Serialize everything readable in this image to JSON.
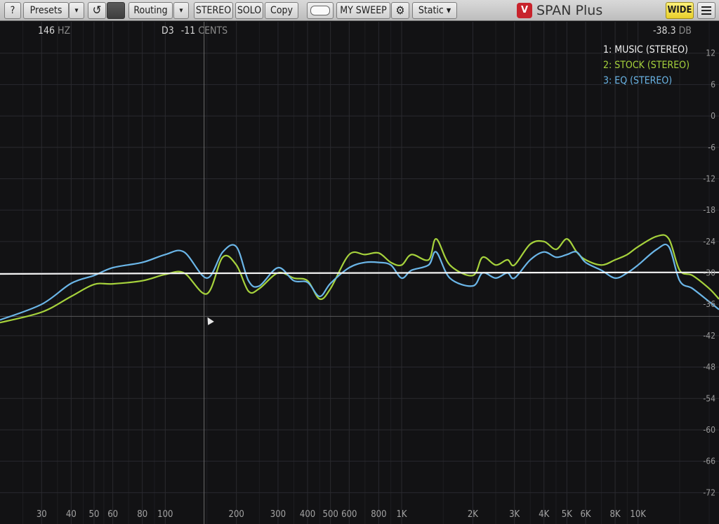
{
  "toolbar": {
    "help_label": "?",
    "presets_label": "Presets",
    "presets_dropdown": "▾",
    "undo_icon": "↺",
    "routing_label": "Routing",
    "routing_dropdown": "▾",
    "stereo_label": "STEREO",
    "solo_label": "SOLO",
    "copy_label": "Copy",
    "sweep_label": "MY SWEEP",
    "static_label": "Static ▾",
    "brand_logo": "V",
    "brand_name": "SPAN Plus",
    "wide_label": "WIDE"
  },
  "readout": {
    "freq_value": "146",
    "freq_unit": "HZ",
    "note": "D3",
    "cents_value": "-11",
    "cents_unit": "CENTS",
    "level_value": "-38.3",
    "level_unit": "DB"
  },
  "legend": [
    {
      "label": "1: MUSIC (STEREO)",
      "color": "#f2f2f2"
    },
    {
      "label": "2: STOCK (STEREO)",
      "color": "#a6d23c"
    },
    {
      "label": "3: EQ (STEREO)",
      "color": "#6bb6e8"
    }
  ],
  "chart_data": {
    "type": "line",
    "x_scale": "log",
    "xlim": [
      20,
      22000
    ],
    "ylim": [
      -78,
      18
    ],
    "grid": true,
    "y_ticks": [
      12,
      6,
      0,
      -6,
      -12,
      -18,
      -24,
      -30,
      -36,
      -42,
      -48,
      -54,
      -60,
      -66,
      -72
    ],
    "x_ticks": [
      {
        "v": 30,
        "label": "30"
      },
      {
        "v": 40,
        "label": "40"
      },
      {
        "v": 50,
        "label": "50"
      },
      {
        "v": 60,
        "label": "60"
      },
      {
        "v": 80,
        "label": "80"
      },
      {
        "v": 100,
        "label": "100"
      },
      {
        "v": 200,
        "label": "200"
      },
      {
        "v": 300,
        "label": "300"
      },
      {
        "v": 400,
        "label": "400"
      },
      {
        "v": 500,
        "label": "500"
      },
      {
        "v": 600,
        "label": "600"
      },
      {
        "v": 800,
        "label": "800"
      },
      {
        "v": 1000,
        "label": "1K"
      },
      {
        "v": 2000,
        "label": "2K"
      },
      {
        "v": 3000,
        "label": "3K"
      },
      {
        "v": 4000,
        "label": "4K"
      },
      {
        "v": 5000,
        "label": "5K"
      },
      {
        "v": 6000,
        "label": "6K"
      },
      {
        "v": 8000,
        "label": "8K"
      },
      {
        "v": 10000,
        "label": "10K"
      }
    ],
    "minor_x": [
      25,
      35,
      45,
      55,
      70,
      90,
      150,
      250,
      350,
      450,
      700,
      900,
      1500,
      2500,
      3500,
      4500,
      7000,
      9000,
      15000,
      20000
    ],
    "cursor_freq": 146,
    "cursor_level": -38.3,
    "series": [
      {
        "name": "1: MUSIC (STEREO)",
        "color": "#f2f2f2",
        "points": [
          [
            20,
            -30.2
          ],
          [
            100,
            -30.1
          ],
          [
            1000,
            -30.0
          ],
          [
            10000,
            -29.9
          ],
          [
            22000,
            -29.9
          ]
        ]
      },
      {
        "name": "2: STOCK (STEREO)",
        "color": "#a6d23c",
        "points": [
          [
            20,
            -39.5
          ],
          [
            30,
            -37.5
          ],
          [
            40,
            -34.5
          ],
          [
            50,
            -32.2
          ],
          [
            60,
            -32.1
          ],
          [
            80,
            -31.5
          ],
          [
            100,
            -30.3
          ],
          [
            120,
            -30.0
          ],
          [
            150,
            -34.0
          ],
          [
            175,
            -27.0
          ],
          [
            200,
            -28.5
          ],
          [
            225,
            -33.5
          ],
          [
            250,
            -33.0
          ],
          [
            300,
            -30.0
          ],
          [
            350,
            -31.0
          ],
          [
            400,
            -31.5
          ],
          [
            450,
            -35.0
          ],
          [
            500,
            -33.0
          ],
          [
            600,
            -26.5
          ],
          [
            700,
            -26.5
          ],
          [
            800,
            -26.2
          ],
          [
            900,
            -28.0
          ],
          [
            1000,
            -28.5
          ],
          [
            1100,
            -26.5
          ],
          [
            1300,
            -27.5
          ],
          [
            1400,
            -23.5
          ],
          [
            1600,
            -28.5
          ],
          [
            2000,
            -30.5
          ],
          [
            2200,
            -27.0
          ],
          [
            2500,
            -28.5
          ],
          [
            2800,
            -27.5
          ],
          [
            3000,
            -28.5
          ],
          [
            3500,
            -24.5
          ],
          [
            4000,
            -24.0
          ],
          [
            4500,
            -25.5
          ],
          [
            5000,
            -23.5
          ],
          [
            5500,
            -26.0
          ],
          [
            6000,
            -27.5
          ],
          [
            7000,
            -28.5
          ],
          [
            8000,
            -27.5
          ],
          [
            9000,
            -26.5
          ],
          [
            10000,
            -25.0
          ],
          [
            12000,
            -23.0
          ],
          [
            13500,
            -23.5
          ],
          [
            15000,
            -29.5
          ],
          [
            17000,
            -30.5
          ],
          [
            20000,
            -33.0
          ],
          [
            22000,
            -35.0
          ]
        ]
      },
      {
        "name": "3: EQ (STEREO)",
        "color": "#6bb6e8",
        "points": [
          [
            20,
            -39.0
          ],
          [
            30,
            -36.0
          ],
          [
            40,
            -32.0
          ],
          [
            50,
            -30.5
          ],
          [
            60,
            -29.0
          ],
          [
            80,
            -28.0
          ],
          [
            100,
            -26.5
          ],
          [
            120,
            -26.0
          ],
          [
            150,
            -31.0
          ],
          [
            175,
            -26.0
          ],
          [
            200,
            -25.0
          ],
          [
            225,
            -31.5
          ],
          [
            250,
            -32.5
          ],
          [
            300,
            -29.0
          ],
          [
            350,
            -31.5
          ],
          [
            400,
            -31.8
          ],
          [
            450,
            -34.5
          ],
          [
            500,
            -32.0
          ],
          [
            600,
            -29.0
          ],
          [
            700,
            -28.0
          ],
          [
            800,
            -28.0
          ],
          [
            900,
            -28.5
          ],
          [
            1000,
            -31.0
          ],
          [
            1100,
            -29.5
          ],
          [
            1300,
            -28.5
          ],
          [
            1400,
            -26.0
          ],
          [
            1600,
            -31.0
          ],
          [
            2000,
            -32.5
          ],
          [
            2200,
            -30.0
          ],
          [
            2500,
            -31.0
          ],
          [
            2800,
            -30.0
          ],
          [
            3000,
            -31.0
          ],
          [
            3500,
            -27.5
          ],
          [
            4000,
            -26.0
          ],
          [
            4500,
            -27.0
          ],
          [
            5000,
            -26.5
          ],
          [
            5500,
            -26.0
          ],
          [
            6000,
            -28.0
          ],
          [
            7000,
            -29.5
          ],
          [
            8000,
            -31.0
          ],
          [
            9000,
            -30.0
          ],
          [
            10000,
            -28.5
          ],
          [
            12000,
            -25.5
          ],
          [
            13500,
            -25.0
          ],
          [
            15000,
            -31.5
          ],
          [
            17000,
            -33.0
          ],
          [
            20000,
            -35.5
          ],
          [
            22000,
            -37.0
          ]
        ]
      }
    ]
  }
}
